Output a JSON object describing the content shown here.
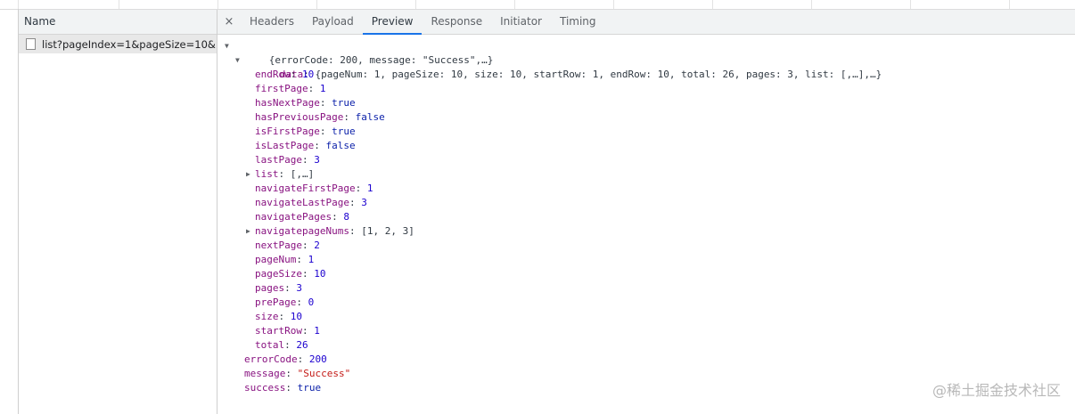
{
  "left": {
    "header": "Name",
    "request": "list?pageIndex=1&pageSize=10&..."
  },
  "tabs": {
    "close": "×",
    "items": [
      "Headers",
      "Payload",
      "Preview",
      "Response",
      "Initiator",
      "Timing"
    ],
    "active": "Preview"
  },
  "preview": {
    "root_summary": "{errorCode: 200, message: \"Success\",…}",
    "data_key": "data",
    "data_summary": "{pageNum: 1, pageSize: 10, size: 10, startRow: 1, endRow: 10, total: 26, pages: 3, list: [,…],…}",
    "data_props": [
      {
        "key": "endRow",
        "value": "10",
        "kind": "num"
      },
      {
        "key": "firstPage",
        "value": "1",
        "kind": "num"
      },
      {
        "key": "hasNextPage",
        "value": "true",
        "kind": "bool"
      },
      {
        "key": "hasPreviousPage",
        "value": "false",
        "kind": "bool"
      },
      {
        "key": "isFirstPage",
        "value": "true",
        "kind": "bool"
      },
      {
        "key": "isLastPage",
        "value": "false",
        "kind": "bool"
      },
      {
        "key": "lastPage",
        "value": "3",
        "kind": "num"
      },
      {
        "key": "list",
        "value": "[,…]",
        "kind": "plain",
        "expandable": true
      },
      {
        "key": "navigateFirstPage",
        "value": "1",
        "kind": "num"
      },
      {
        "key": "navigateLastPage",
        "value": "3",
        "kind": "num"
      },
      {
        "key": "navigatePages",
        "value": "8",
        "kind": "num"
      },
      {
        "key": "navigatepageNums",
        "value": "[1, 2, 3]",
        "kind": "plain",
        "expandable": true
      },
      {
        "key": "nextPage",
        "value": "2",
        "kind": "num"
      },
      {
        "key": "pageNum",
        "value": "1",
        "kind": "num"
      },
      {
        "key": "pageSize",
        "value": "10",
        "kind": "num"
      },
      {
        "key": "pages",
        "value": "3",
        "kind": "num"
      },
      {
        "key": "prePage",
        "value": "0",
        "kind": "num"
      },
      {
        "key": "size",
        "value": "10",
        "kind": "num"
      },
      {
        "key": "startRow",
        "value": "1",
        "kind": "num"
      },
      {
        "key": "total",
        "value": "26",
        "kind": "num"
      }
    ],
    "root_props": [
      {
        "key": "errorCode",
        "value": "200",
        "kind": "num"
      },
      {
        "key": "message",
        "value": "\"Success\"",
        "kind": "str"
      },
      {
        "key": "success",
        "value": "true",
        "kind": "bool"
      }
    ]
  },
  "watermark": "@稀土掘金技术社区",
  "icons": {
    "expanded": "triangle-down-icon",
    "collapsed": "triangle-right-icon",
    "request": "document-icon",
    "close": "close-icon"
  }
}
